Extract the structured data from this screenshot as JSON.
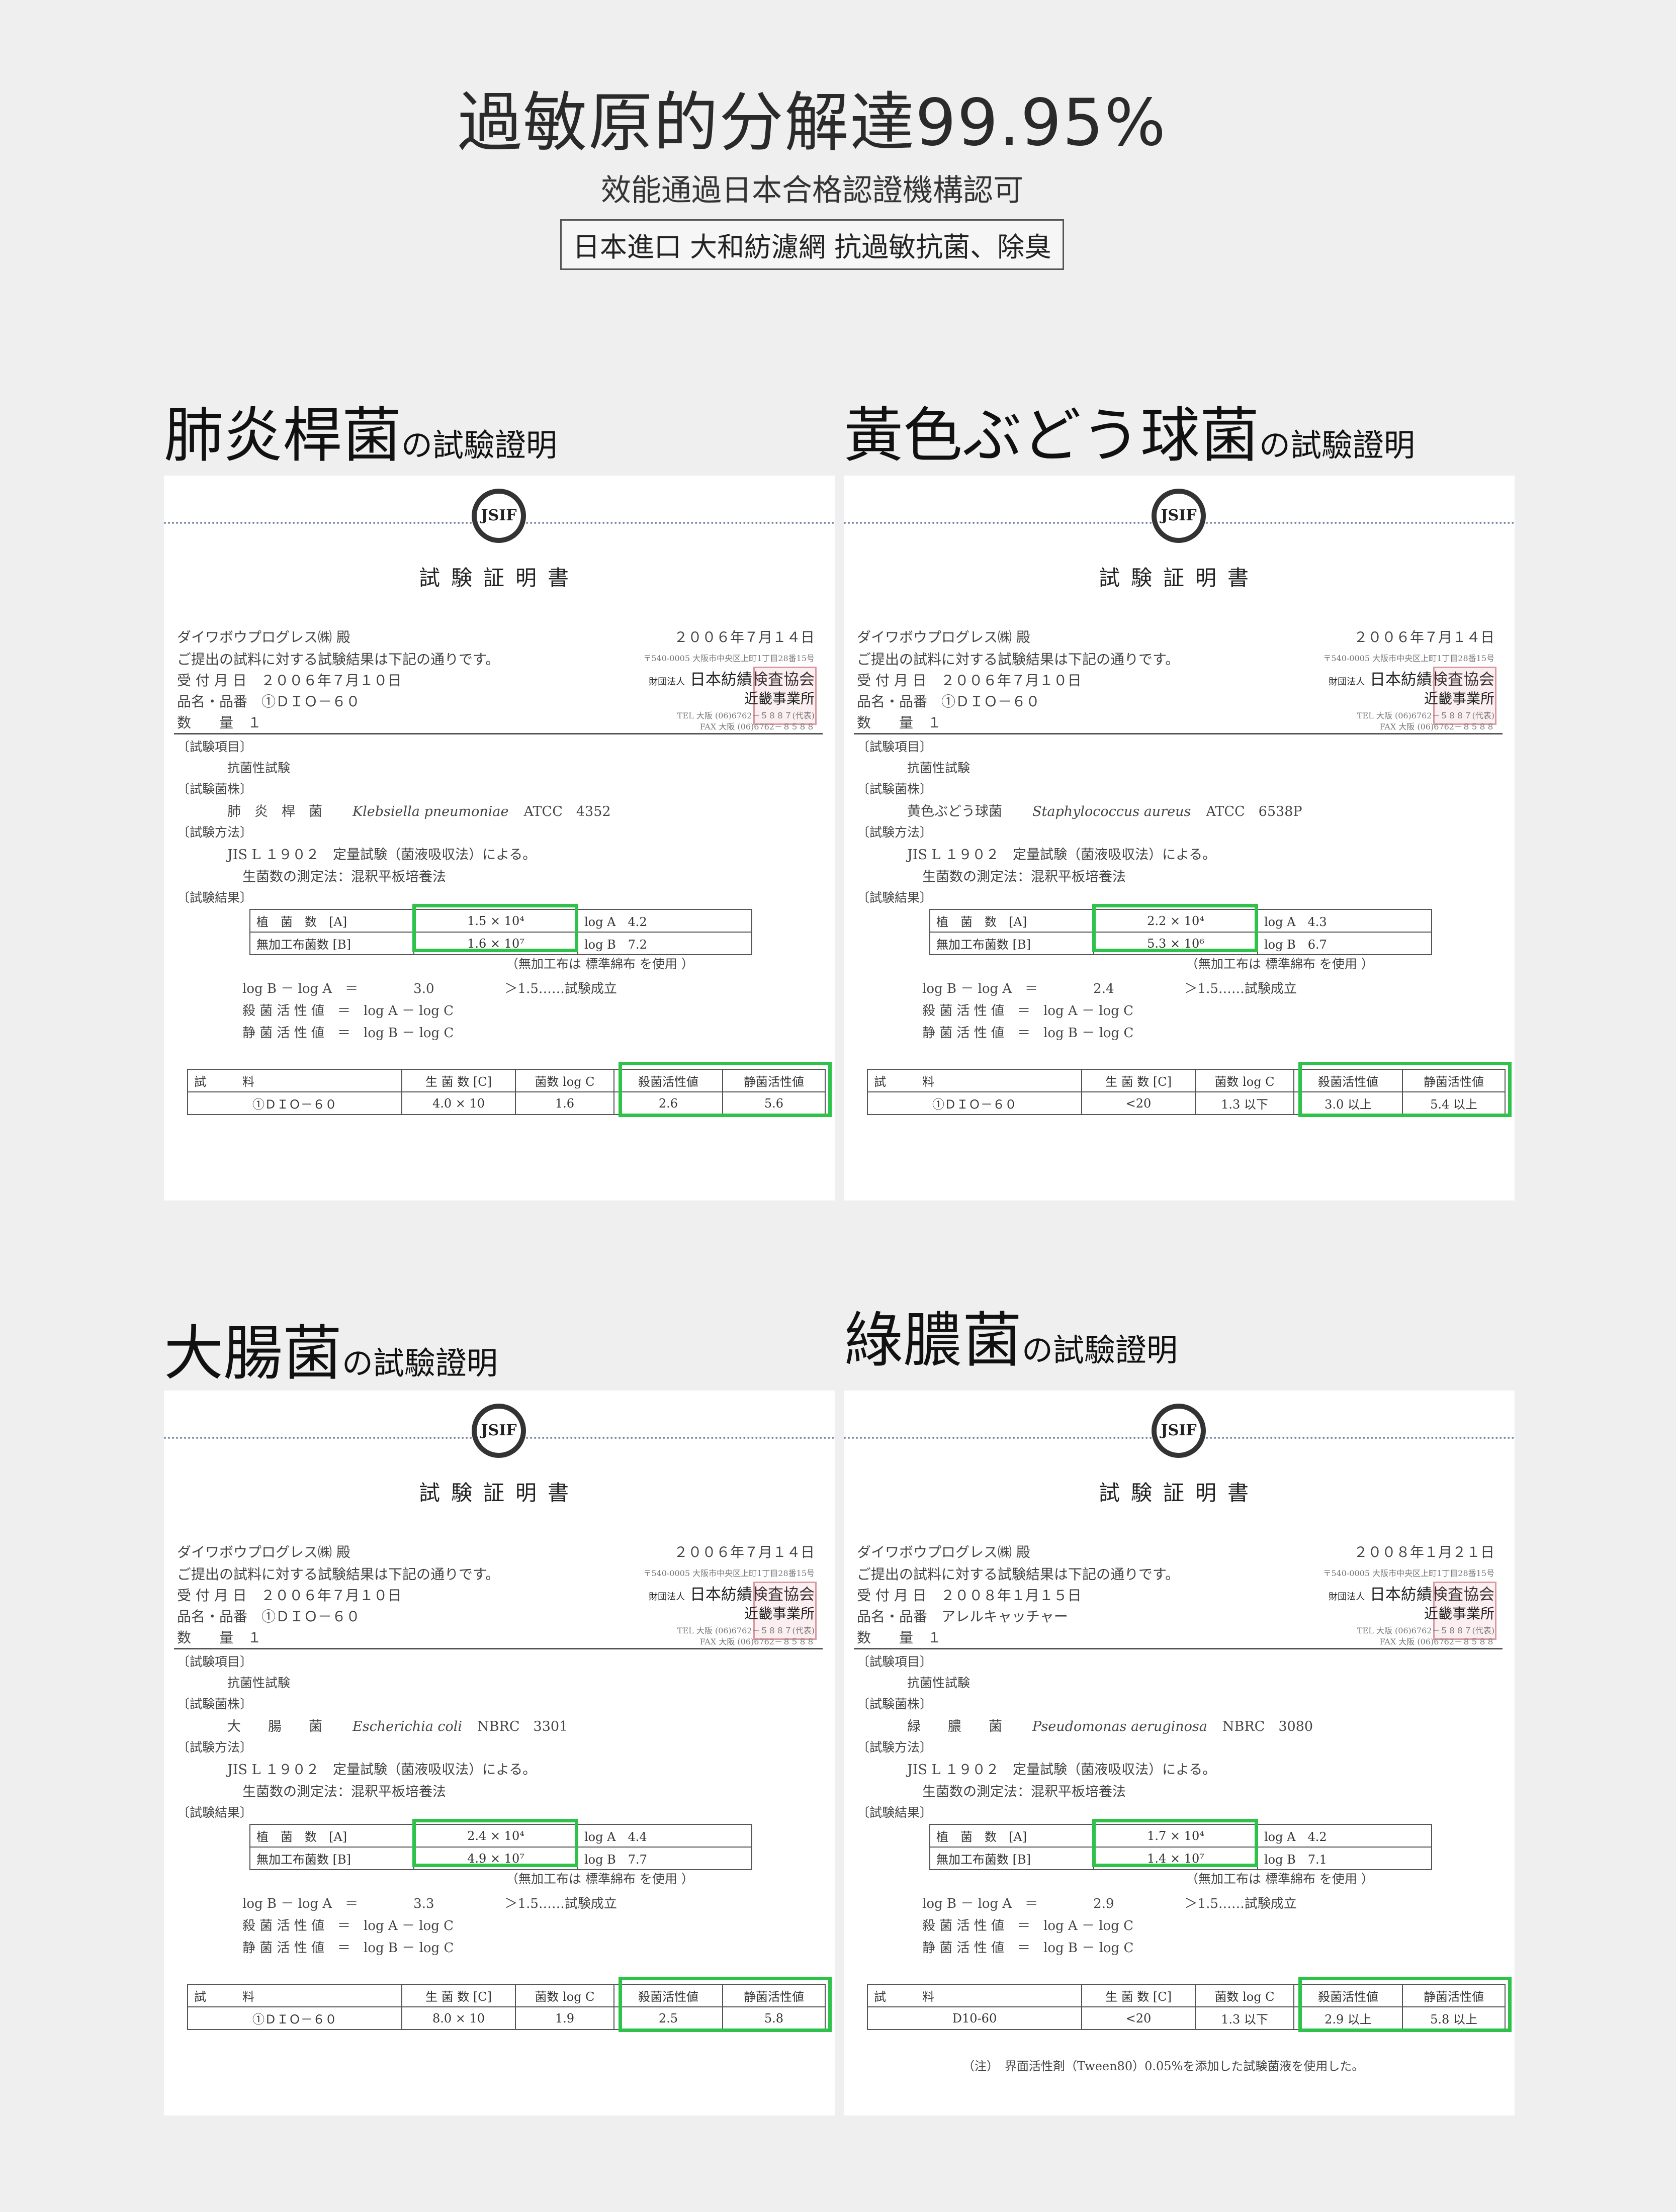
{
  "header": {
    "title": "過敏原的分解達99.95%",
    "subtitle": "效能通過日本合格認證機構認可",
    "tag": "日本進口 大和紡濾網 抗過敏抗菌、除臭"
  },
  "sections": [
    {
      "title_big": "肺炎桿菌",
      "title_small": "の試驗證明",
      "doc": {
        "seal_text": "JSIF",
        "doc_title": "試験証明書",
        "addressee": "ダイワボウプログレス㈱ 殿",
        "date": "２００６年７月１４日",
        "intro": "ご提出の試料に対する試験結果は下記の通りです。",
        "address": "〒540-0005 大阪市中央区上町1丁目28番15号",
        "org_prefix": "財団法人",
        "org": "日本紡績検査協会",
        "office": "近畿事業所",
        "tel": "TEL 大阪 (06)6762－５８８７(代表)",
        "fax": "FAX 大阪 (06)6762－８５８８",
        "received": "受 付 月 日　２００６年７月１０日",
        "product": "品名・品番　①ＤＩＯ－６０",
        "quantity": "数　　量　１",
        "test_item_h": "〔試験項目〕",
        "test_item": "抗菌性試験",
        "strain_h": "〔試験菌株〕",
        "strain_jp": "肺　炎　桿　菌",
        "strain_latin": "Klebsiella pneumoniae",
        "strain_code": "ATCC　4352",
        "method_h": "〔試験方法〕",
        "method1": "JIS L １９０２　定量試験（菌液吸収法）による。",
        "method2": "生菌数の測定法：混釈平板培養法",
        "result_h": "〔試験結果〕",
        "r1_label": "植　菌　数　[A]",
        "r1_value": "1.5 × 10⁴",
        "r1_log": "log A　4.2",
        "r2_label": "無加工布菌数 [B]",
        "r2_value": "1.6 × 10⁷",
        "r2_log": "log B　7.2",
        "note": "（無加工布は 標準綿布 を使用 ）",
        "calc1_left": "log B － log A　＝",
        "calc1_mid": "3.0",
        "calc1_right": "＞1.5……試験成立",
        "calc2": "殺 菌 活 性 値　＝　log A － log C",
        "calc3": "静 菌 活 性 値　＝　log B － log C",
        "table_headers": [
          "試　　　料",
          "生 菌 数 [C]",
          "菌数 log C",
          "殺菌活性値",
          "静菌活性値"
        ],
        "table_row": [
          "①ＤＩＯ－６０",
          "4.0 × 10",
          "1.6",
          "2.6",
          "5.6"
        ],
        "footnote": ""
      }
    },
    {
      "title_big": "黃色ぶどう球菌",
      "title_small": "の試驗證明",
      "doc": {
        "seal_text": "JSIF",
        "doc_title": "試験証明書",
        "addressee": "ダイワボウプログレス㈱ 殿",
        "date": "２００６年７月１４日",
        "intro": "ご提出の試料に対する試験結果は下記の通りです。",
        "address": "〒540-0005 大阪市中央区上町1丁目28番15号",
        "org_prefix": "財団法人",
        "org": "日本紡績検査協会",
        "office": "近畿事業所",
        "tel": "TEL 大阪 (06)6762－５８８７(代表)",
        "fax": "FAX 大阪 (06)6762－８５８８",
        "received": "受 付 月 日　２００６年７月１０日",
        "product": "品名・品番　①ＤＩＯ－６０",
        "quantity": "数　　量　１",
        "test_item_h": "〔試験項目〕",
        "test_item": "抗菌性試験",
        "strain_h": "〔試験菌株〕",
        "strain_jp": "黄色ぶどう球菌",
        "strain_latin": "Staphylococcus aureus",
        "strain_code": "ATCC　6538P",
        "method_h": "〔試験方法〕",
        "method1": "JIS L １９０２　定量試験（菌液吸収法）による。",
        "method2": "生菌数の測定法：混釈平板培養法",
        "result_h": "〔試験結果〕",
        "r1_label": "植　菌　数　[A]",
        "r1_value": "2.2 × 10⁴",
        "r1_log": "log A　4.3",
        "r2_label": "無加工布菌数 [B]",
        "r2_value": "5.3 × 10⁶",
        "r2_log": "log B　6.7",
        "note": "（無加工布は 標準綿布 を使用 ）",
        "calc1_left": "log B － log A　＝",
        "calc1_mid": "2.4",
        "calc1_right": "＞1.5……試験成立",
        "calc2": "殺 菌 活 性 値　＝　log A － log C",
        "calc3": "静 菌 活 性 値　＝　log B － log C",
        "table_headers": [
          "試　　　料",
          "生 菌 数 [C]",
          "菌数 log C",
          "殺菌活性値",
          "静菌活性値"
        ],
        "table_row": [
          "①ＤＩＯ－６０",
          "<20",
          "1.3 以下",
          "3.0 以上",
          "5.4 以上"
        ],
        "footnote": ""
      }
    },
    {
      "title_big": "大腸菌",
      "title_small": "の試驗證明",
      "doc": {
        "seal_text": "JSIF",
        "doc_title": "試験証明書",
        "addressee": "ダイワボウプログレス㈱ 殿",
        "date": "２００６年７月１４日",
        "intro": "ご提出の試料に対する試験結果は下記の通りです。",
        "address": "〒540-0005 大阪市中央区上町1丁目28番15号",
        "org_prefix": "財団法人",
        "org": "日本紡績検査協会",
        "office": "近畿事業所",
        "tel": "TEL 大阪 (06)6762－５８８７(代表)",
        "fax": "FAX 大阪 (06)6762－８５８８",
        "received": "受 付 月 日　２００６年７月１０日",
        "product": "品名・品番　①ＤＩＯ－６０",
        "quantity": "数　　量　１",
        "test_item_h": "〔試験項目〕",
        "test_item": "抗菌性試験",
        "strain_h": "〔試験菌株〕",
        "strain_jp": "大　　腸　　菌",
        "strain_latin": "Escherichia coli",
        "strain_code": "NBRC　3301",
        "method_h": "〔試験方法〕",
        "method1": "JIS L １９０２　定量試験（菌液吸収法）による。",
        "method2": "生菌数の測定法：混釈平板培養法",
        "result_h": "〔試験結果〕",
        "r1_label": "植　菌　数　[A]",
        "r1_value": "2.4 × 10⁴",
        "r1_log": "log A　4.4",
        "r2_label": "無加工布菌数 [B]",
        "r2_value": "4.9 × 10⁷",
        "r2_log": "log B　7.7",
        "note": "（無加工布は 標準綿布 を使用 ）",
        "calc1_left": "log B － log A　＝",
        "calc1_mid": "3.3",
        "calc1_right": "＞1.5……試験成立",
        "calc2": "殺 菌 活 性 値　＝　log A － log C",
        "calc3": "静 菌 活 性 値　＝　log B － log C",
        "table_headers": [
          "試　　　料",
          "生 菌 数 [C]",
          "菌数 log C",
          "殺菌活性値",
          "静菌活性値"
        ],
        "table_row": [
          "①ＤＩＯ－６０",
          "8.0 × 10",
          "1.9",
          "2.5",
          "5.8"
        ],
        "footnote": ""
      }
    },
    {
      "title_big": "綠膿菌",
      "title_small": "の試驗證明",
      "doc": {
        "seal_text": "JSIF",
        "doc_title": "試験証明書",
        "addressee": "ダイワボウプログレス㈱ 殿",
        "date": "２００８年１月２１日",
        "intro": "ご提出の試料に対する試験結果は下記の通りです。",
        "address": "〒540-0005 大阪市中央区上町1丁目28番15号",
        "org_prefix": "財団法人",
        "org": "日本紡績検査協会",
        "office": "近畿事業所",
        "tel": "TEL 大阪 (06)6762－５８８７(代表)",
        "fax": "FAX 大阪 (06)6762－８５８８",
        "received": "受 付 月 日　２００８年１月１５日",
        "product": "品名・品番　アレルキャッチャー",
        "quantity": "数　　量　１",
        "test_item_h": "〔試験項目〕",
        "test_item": "抗菌性試験",
        "strain_h": "〔試験菌株〕",
        "strain_jp": "緑　　膿　　菌",
        "strain_latin": "Pseudomonas aeruginosa",
        "strain_code": "NBRC　3080",
        "method_h": "〔試験方法〕",
        "method1": "JIS L １９０２　定量試験（菌液吸収法）による。",
        "method2": "生菌数の測定法：混釈平板培養法",
        "result_h": "〔試験結果〕",
        "r1_label": "植　菌　数　[A]",
        "r1_value": "1.7 × 10⁴",
        "r1_log": "log A　4.2",
        "r2_label": "無加工布菌数 [B]",
        "r2_value": "1.4 × 10⁷",
        "r2_log": "log B　7.1",
        "note": "（無加工布は 標準綿布 を使用 ）",
        "calc1_left": "log B － log A　＝",
        "calc1_mid": "2.9",
        "calc1_right": "＞1.5……試験成立",
        "calc2": "殺 菌 活 性 値　＝　log A － log C",
        "calc3": "静 菌 活 性 値　＝　log B － log C",
        "table_headers": [
          "試　　　料",
          "生 菌 数 [C]",
          "菌数 log C",
          "殺菌活性値",
          "静菌活性値"
        ],
        "table_row": [
          "D10-60",
          "<20",
          "1.3 以下",
          "2.9 以上",
          "5.8 以上"
        ],
        "footnote": "（注）　界面活性剤（Tween80）0.05%を添加した試験菌液を使用した。"
      }
    }
  ],
  "colors": {
    "highlight": "#2ec24a",
    "background": "#efefef",
    "paper": "#ffffff"
  }
}
